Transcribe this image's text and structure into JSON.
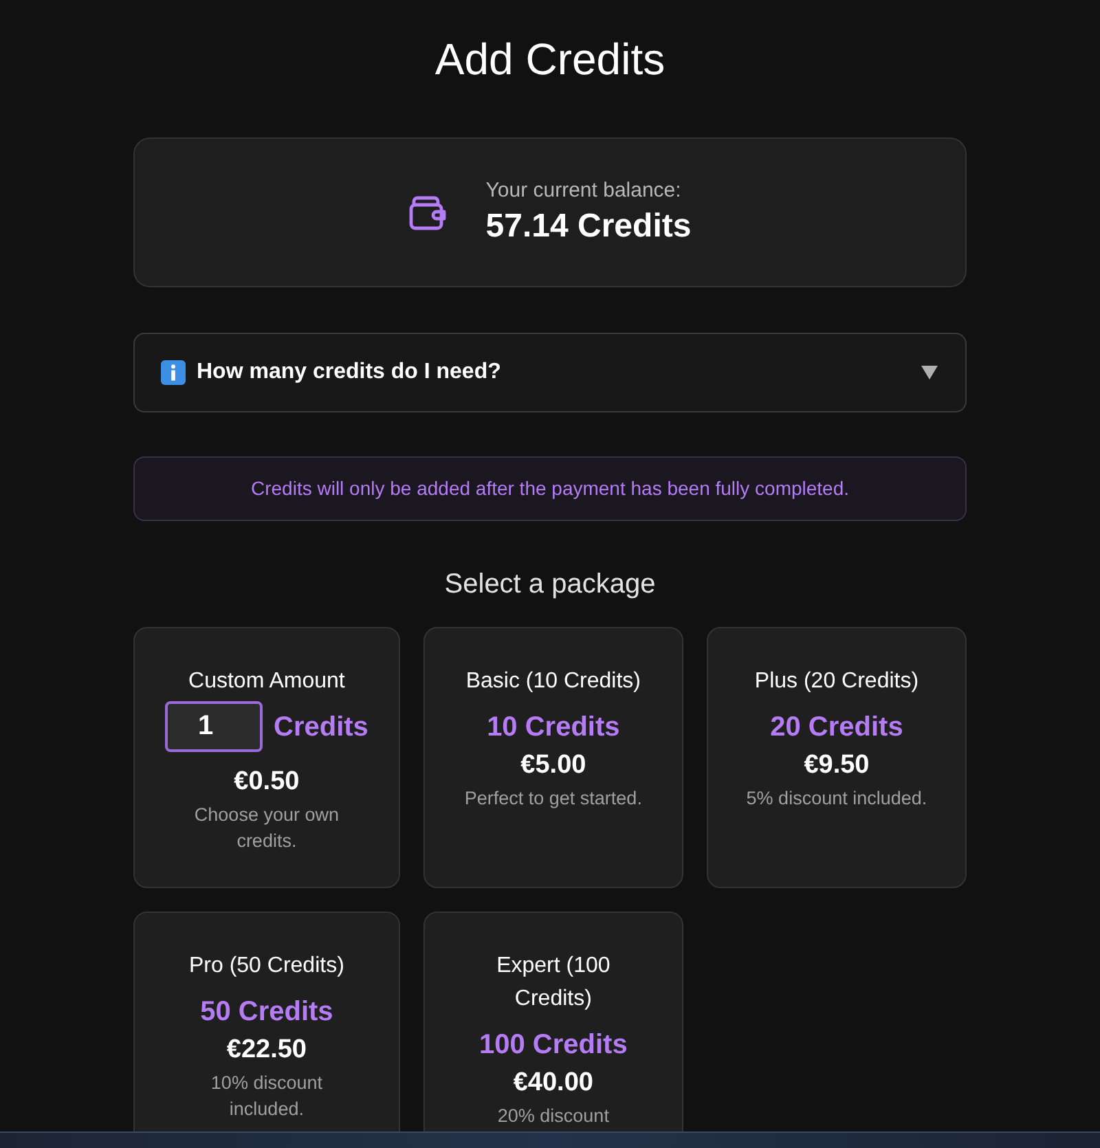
{
  "title": "Add Credits",
  "balance": {
    "label": "Your current balance:",
    "value": "57.14 Credits"
  },
  "faq": {
    "question": "How many credits do I need?",
    "expanded": false
  },
  "notice": "Credits will only be added after the payment has been fully completed.",
  "packages_heading": "Select a package",
  "packages": [
    {
      "kind": "custom",
      "name": "Custom Amount",
      "amount": "1",
      "credits": "Credits",
      "price": "€0.50",
      "description": "Choose your own credits."
    },
    {
      "kind": "fixed",
      "name": "Basic (10 Credits)",
      "credits": "10 Credits",
      "price": "€5.00",
      "description": "Perfect to get started."
    },
    {
      "kind": "fixed",
      "name": "Plus (20 Credits)",
      "credits": "20 Credits",
      "price": "€9.50",
      "description": "5% discount included."
    },
    {
      "kind": "fixed",
      "name": "Pro (50 Credits)",
      "credits": "50 Credits",
      "price": "€22.50",
      "description": "10% discount included."
    },
    {
      "kind": "fixed",
      "name": "Expert (100 Credits)",
      "credits": "100 Credits",
      "price": "€40.00",
      "description": "20% discount"
    }
  ]
}
